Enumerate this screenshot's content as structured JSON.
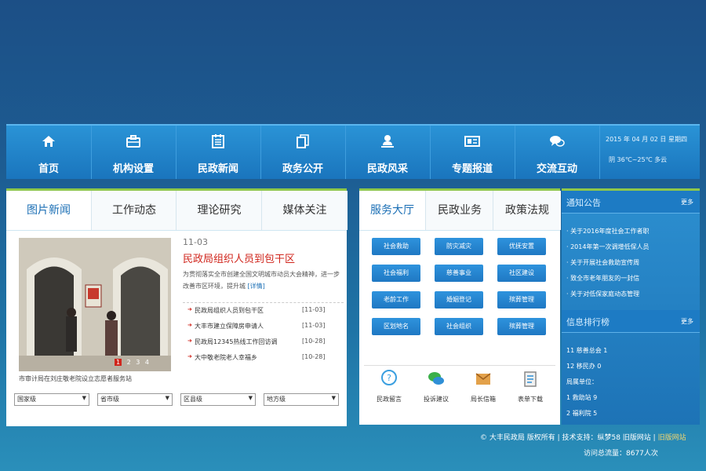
{
  "nav": {
    "items": [
      {
        "label": "首页",
        "icon": "home-icon"
      },
      {
        "label": "机构设置",
        "icon": "briefcase-icon"
      },
      {
        "label": "民政新闻",
        "icon": "clipboard-icon"
      },
      {
        "label": "政务公开",
        "icon": "document-icon"
      },
      {
        "label": "民政风采",
        "icon": "bell-icon"
      },
      {
        "label": "专题报道",
        "icon": "id-card-icon"
      },
      {
        "label": "交流互动",
        "icon": "chat-icon"
      }
    ],
    "date": "2015 年 04 月 02 日 星期四",
    "weather": "阴 36℃~25℃ 多云"
  },
  "left": {
    "tabs": [
      "图片新闻",
      "工作动态",
      "理论研究",
      "媒体关注"
    ],
    "photo_caption": "市审计局在刘庄敬老院设立志愿者服务站",
    "photo_pages": [
      "1",
      "2",
      "3",
      "4"
    ],
    "featured": {
      "date": "11-03",
      "title": "民政局组织人员到包干区",
      "summary": "为贯彻落实全市创建全国文明城市动员大会精神，进一步改善市区环境，提升城",
      "more": "[详情]"
    },
    "news": [
      {
        "title": "民政局组织人员到包干区",
        "date": "[11-03]"
      },
      {
        "title": "大丰市建立保障房申请人",
        "date": "[11-03]"
      },
      {
        "title": "民政局12345热线工作回访调",
        "date": "[10-28]"
      },
      {
        "title": "大中敬老院老人幸福乡",
        "date": "[10-28]"
      }
    ],
    "selects": [
      "国家级",
      "省市级",
      "区县级",
      "地方级"
    ]
  },
  "middle": {
    "tabs": [
      "服务大厅",
      "民政业务",
      "政策法规"
    ],
    "services": [
      "社会救助",
      "防灾减灾",
      "优抚安置",
      "社会福利",
      "慈善事业",
      "社区建设",
      "老龄工作",
      "婚姻登记",
      "殡葬管理",
      "区划地名",
      "社会组织",
      "殡葬管理"
    ],
    "quick": [
      {
        "label": "民政留言",
        "icon": "question-icon"
      },
      {
        "label": "投诉建议",
        "icon": "chat-bubbles-icon"
      },
      {
        "label": "局长信箱",
        "icon": "mailbox-icon"
      },
      {
        "label": "表单下载",
        "icon": "form-icon"
      }
    ]
  },
  "right": {
    "notice_title": "通知公告",
    "notice_more": "更多",
    "notices": [
      "关于2016年度社会工作者职",
      "2014年第一次调增低保人员",
      "关于开展社会救助宣传周",
      "致全市老年朋友的一封信",
      "关于对低保家庭动态管理"
    ],
    "rank_title": "信息排行榜",
    "rank_more": "更多",
    "ranks": [
      "11 慈善总会 1",
      "12 移民办 0",
      "局属单位：",
      "1 救助站 9",
      "2 福利院 5"
    ]
  },
  "footer": {
    "line1": "© 大丰民政局  版权所有 | 技术支持：纵梦58  旧版网站 |",
    "line1_link": "旧版网站",
    "visits": "访问总流量：8677人次"
  },
  "colors": {
    "accent": "#1b6fb5",
    "nav_bg": "#1f80c6",
    "highlight_red": "#d0251c",
    "tab_border": "#8fc74a"
  }
}
